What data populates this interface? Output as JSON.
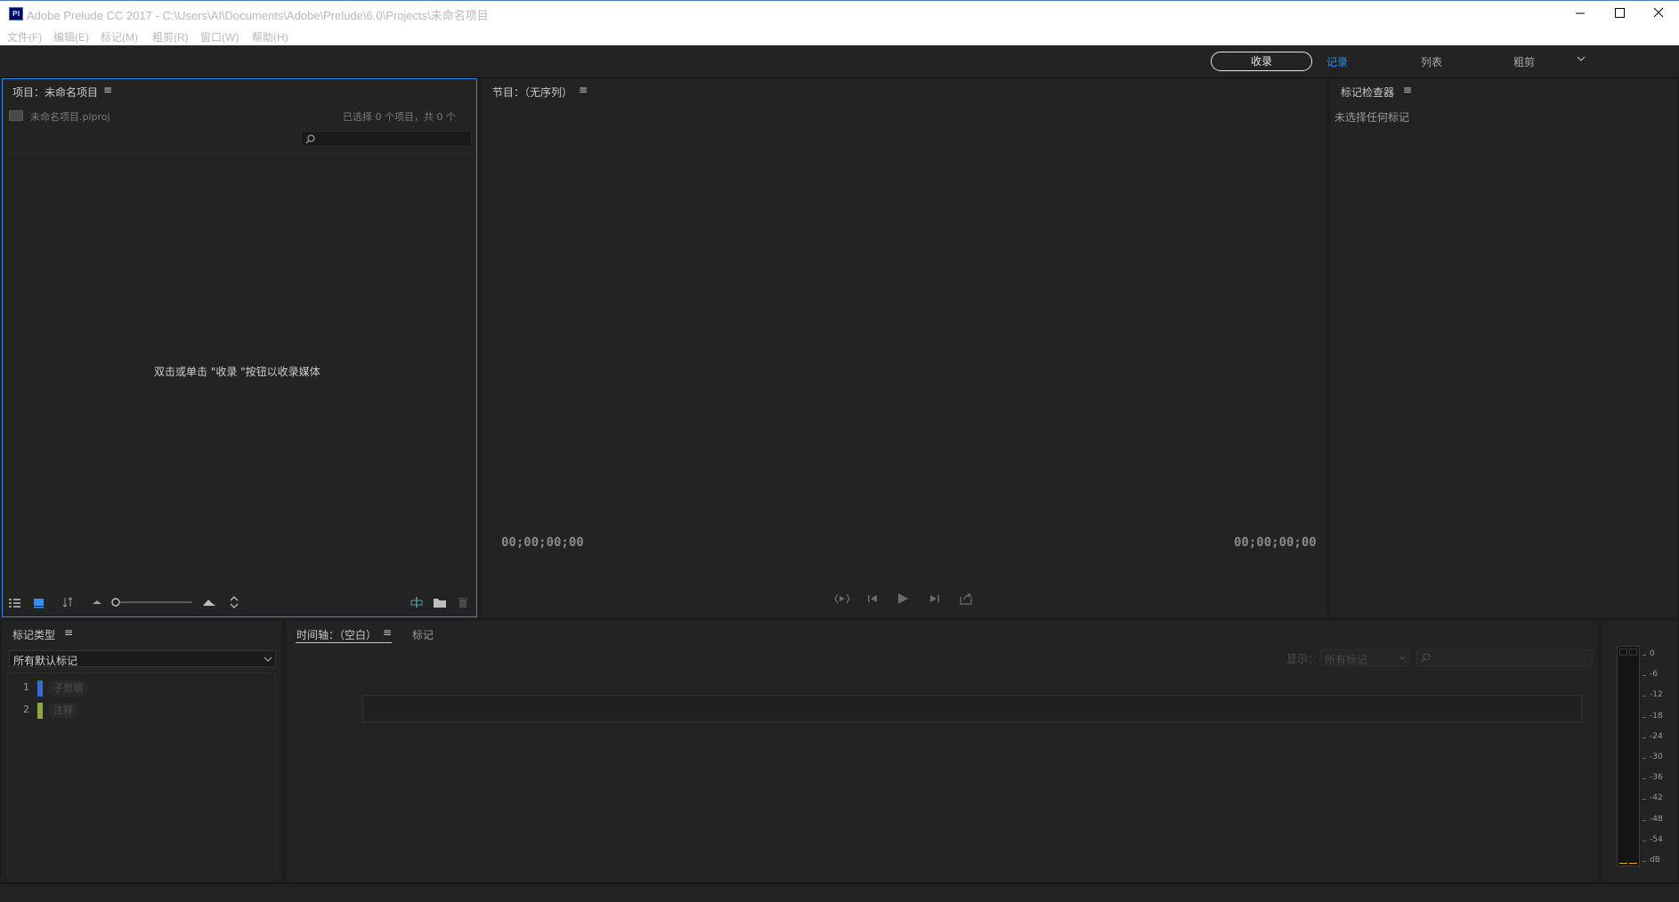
{
  "window": {
    "app_icon_label": "Pl",
    "title": "Adobe Prelude CC 2017 - C:\\Users\\AI\\Documents\\Adobe\\Prelude\\6.0\\Projects\\未命名项目"
  },
  "menu": [
    "文件(F)",
    "编辑(E)",
    "标记(M)",
    "粗剪(R)",
    "窗口(W)",
    "帮助(H)"
  ],
  "workspace": {
    "ingest_label": "收录",
    "tabs": [
      "记录",
      "列表",
      "粗剪"
    ],
    "active_tab": "记录",
    "accent": "#2d8ceb"
  },
  "project_panel": {
    "title": "项目：未命名项目",
    "file_name": "未命名项目.plproj",
    "selection_info": "已选择 0 个项目，共 0 个",
    "empty_hint": "双击或单击 \"收录 \"按钮以收录媒体"
  },
  "program_panel": {
    "title": "节目：（无序列）",
    "timecode_left": "00;00;00;00",
    "timecode_right": "00;00;00;00"
  },
  "inspector_panel": {
    "title": "标记检查器",
    "empty_text": "未选择任何标记"
  },
  "marker_types_panel": {
    "title": "标记类型",
    "dropdown_value": "所有默认标记",
    "items": [
      {
        "num": "1",
        "label": "子剪辑",
        "color": "#2f6fd1"
      },
      {
        "num": "2",
        "label": "注释",
        "color": "#8fa83a"
      }
    ]
  },
  "timeline_panel": {
    "tab_timeline": "时间轴：（空白）",
    "tab_markers": "标记",
    "display_label": "显示：",
    "display_value": "所有标记"
  },
  "audio_meter": {
    "labels": [
      "0",
      "-6",
      "-12",
      "-18",
      "-24",
      "-30",
      "-36",
      "-42",
      "-48",
      "-54",
      "dB"
    ]
  }
}
